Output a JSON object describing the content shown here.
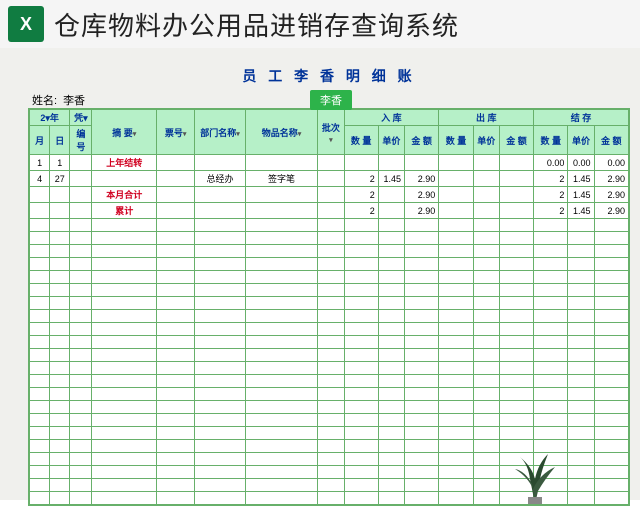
{
  "titlebar": {
    "app_title": "仓库物料办公用品进销存查询系统"
  },
  "doc": {
    "title": "员 工  李 香  明  细  账",
    "name_label": "姓名:",
    "name_value": "李香",
    "chip": "李香"
  },
  "headers": {
    "group_date": "2▾年",
    "group_ser": "凭▾",
    "group_desc": "摘    要",
    "group_pn": "票号",
    "group_dept": "部门名称",
    "group_item": "物品名称",
    "group_batch": "批次",
    "group_in": "入        库",
    "group_out": "出        库",
    "group_bal": "结        存",
    "month": "月",
    "day": "日",
    "serial": "编号",
    "qty": "数 量",
    "price": "单价",
    "amt": "金  额"
  },
  "rows": [
    {
      "m": "1",
      "d": "1",
      "sn": "",
      "desc": "上年结转",
      "desc_cls": "red",
      "pn": "",
      "dept": "",
      "item": "",
      "bat": "",
      "iq": "",
      "ip": "",
      "ia": "",
      "oq": "",
      "op": "",
      "oa": "",
      "bq": "0.00",
      "bp": "0.00",
      "ba": "0.00"
    },
    {
      "m": "4",
      "d": "27",
      "sn": "",
      "desc": "",
      "desc_cls": "",
      "pn": "",
      "dept": "总经办",
      "item": "签字笔",
      "bat": "",
      "iq": "2",
      "ip": "1.45",
      "ia": "2.90",
      "oq": "",
      "op": "",
      "oa": "",
      "bq": "2",
      "bp": "1.45",
      "ba": "2.90"
    },
    {
      "m": "",
      "d": "",
      "sn": "",
      "desc": "本月合计",
      "desc_cls": "red",
      "pn": "",
      "dept": "",
      "item": "",
      "bat": "",
      "iq": "2",
      "ip": "",
      "ia": "2.90",
      "oq": "",
      "op": "",
      "oa": "",
      "bq": "2",
      "bp": "1.45",
      "ba": "2.90"
    },
    {
      "m": "",
      "d": "",
      "sn": "",
      "desc": "累计",
      "desc_cls": "red",
      "pn": "",
      "dept": "",
      "item": "",
      "bat": "",
      "iq": "2",
      "ip": "",
      "ia": "2.90",
      "oq": "",
      "op": "",
      "oa": "",
      "bq": "2",
      "bp": "1.45",
      "ba": "2.90"
    }
  ],
  "empty_rows": 22
}
